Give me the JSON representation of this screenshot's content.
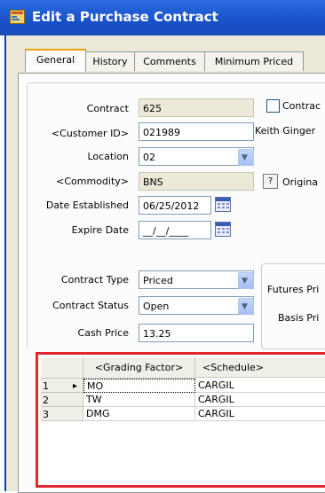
{
  "window": {
    "title": "Edit a Purchase Contract"
  },
  "tabs": [
    {
      "label": "General"
    },
    {
      "label": "History"
    },
    {
      "label": "Comments"
    },
    {
      "label": "Minimum Priced"
    }
  ],
  "form": {
    "contract_label": "Contract",
    "contract_value": "625",
    "contract_checkbox_label": "Contrac",
    "customer_label": "<Customer ID>",
    "customer_value": "021989",
    "customer_name": "Keith Ginger",
    "location_label": "Location",
    "location_value": "02",
    "commodity_label": "<Commodity>",
    "commodity_value": "BNS",
    "help_label": "?",
    "origin_label": "Origina",
    "date_established_label": "Date Established",
    "date_established_value": "06/25/2012",
    "expire_date_label": "Expire Date",
    "expire_date_value": "__/__/____",
    "contract_type_label": "Contract Type",
    "contract_type_value": "Priced",
    "contract_status_label": "Contract Status",
    "contract_status_value": "Open",
    "cash_price_label": "Cash Price",
    "cash_price_value": "13.25",
    "futures_price_label": "Futures Pri",
    "basis_price_label": "Basis Pri"
  },
  "grid": {
    "columns": [
      "<Grading Factor>",
      "<Schedule>"
    ],
    "current_row_marker": "▸",
    "rows": [
      {
        "num": "1",
        "factor": "MO",
        "schedule": "CARGIL"
      },
      {
        "num": "2",
        "factor": "TW",
        "schedule": "CARGIL"
      },
      {
        "num": "3",
        "factor": "DMG",
        "schedule": "CARGIL"
      }
    ]
  },
  "colors": {
    "titlebar": "#1f5bd3",
    "window_bg": "#ece9d8",
    "highlight": "#e3262e",
    "active_tab_accent": "#f0a20a"
  }
}
